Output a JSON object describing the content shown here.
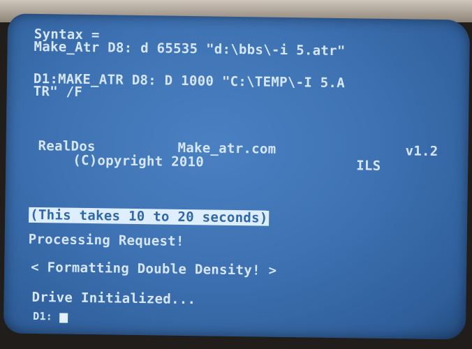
{
  "screen": {
    "syntax_label": "Syntax =",
    "syntax_example": "Make_Atr D8: d 65535 \"d:\\bbs\\-i 5.atr\"",
    "command_line_1": "D1:MAKE_ATR D8: D 1000 \"C:\\TEMP\\-I 5.A",
    "command_line_2": "TR\" /F",
    "banner_left": "RealDos",
    "banner_title": "Make_atr.com",
    "banner_version": "v1.2",
    "copyright": "(C)opyright 2010",
    "copyright_author": "ILS",
    "timing_notice": "(This takes 10 to 20 seconds)",
    "processing": "Processing Request!",
    "formatting": "< Formatting Double Density! >",
    "initialized": "Drive Initialized...",
    "prompt": "D1:"
  }
}
